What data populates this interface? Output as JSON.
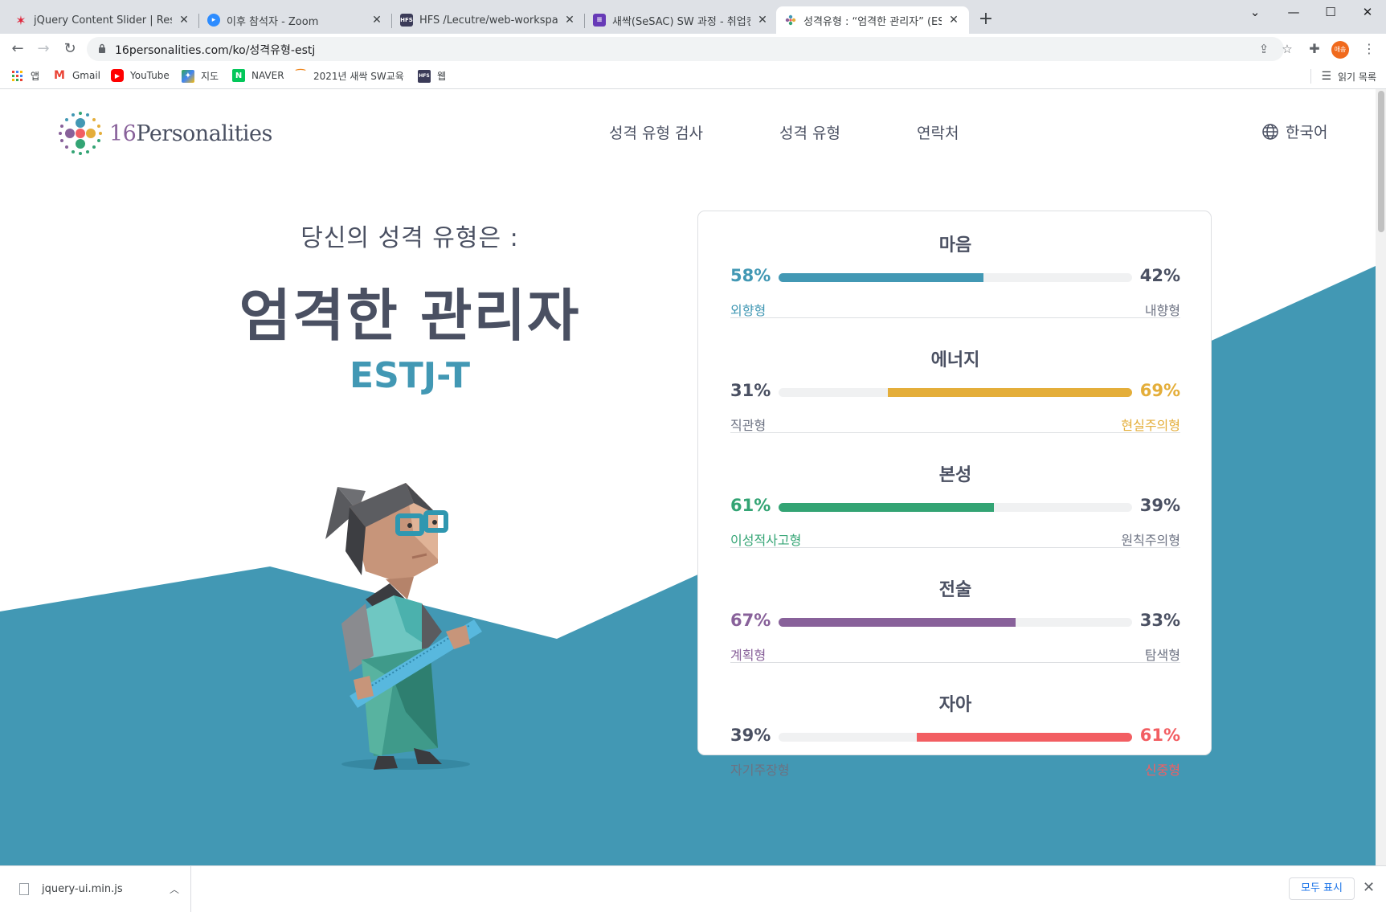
{
  "browser": {
    "tabs": [
      {
        "title": "jQuery Content Slider | Respons",
        "favicon": "red-star"
      },
      {
        "title": "이후 참석자 - Zoom",
        "favicon": "zoom"
      },
      {
        "title": "HFS /Lecutre/web-workspace/Le",
        "favicon": "hfs"
      },
      {
        "title": "새싹(SeSAC) SW 과정 - 취업컨설",
        "favicon": "forms"
      },
      {
        "title": "성격유형 : “엄격한 관리자” (EST.",
        "favicon": "16p"
      }
    ],
    "url": "16personalities.com/ko/성격유형-estj",
    "profile_label": "애송",
    "bookmarks": [
      {
        "label": "앱",
        "icon": "apps-grid-icon"
      },
      {
        "label": "Gmail",
        "icon": "gmail-icon"
      },
      {
        "label": "YouTube",
        "icon": "youtube-icon"
      },
      {
        "label": "지도",
        "icon": "maps-icon"
      },
      {
        "label": "NAVER",
        "icon": "naver-icon"
      },
      {
        "label": "2021년 새싹 SW교육",
        "icon": "sesac-icon"
      },
      {
        "label": "웹",
        "icon": "hfs-icon"
      }
    ],
    "reading_list": "읽기 목록"
  },
  "site": {
    "logo_num": "16",
    "logo_word": "Personalities",
    "nav": [
      "성격 유형 검사",
      "성격 유형",
      "연락처"
    ],
    "language": "한국어"
  },
  "result": {
    "intro": "당신의 성격 유형은 :",
    "type_name": "엄격한 관리자",
    "type_code": "ESTJ-T"
  },
  "traits": [
    {
      "name": "마음",
      "left_pct": "58%",
      "right_pct": "42%",
      "left_label": "외향형",
      "right_label": "내향형",
      "dominant": "left",
      "fill": 0.58,
      "color": "#4298b4"
    },
    {
      "name": "에너지",
      "left_pct": "31%",
      "right_pct": "69%",
      "left_label": "직관형",
      "right_label": "현실주의형",
      "dominant": "right",
      "fill": 0.69,
      "color": "#e4ae3a"
    },
    {
      "name": "본성",
      "left_pct": "61%",
      "right_pct": "39%",
      "left_label": "이성적사고형",
      "right_label": "원칙주의형",
      "dominant": "left",
      "fill": 0.61,
      "color": "#33a474"
    },
    {
      "name": "전술",
      "left_pct": "67%",
      "right_pct": "33%",
      "left_label": "계획형",
      "right_label": "탐색형",
      "dominant": "left",
      "fill": 0.67,
      "color": "#88619a"
    },
    {
      "name": "자아",
      "left_pct": "39%",
      "right_pct": "61%",
      "left_label": "자기주장형",
      "right_label": "신중형",
      "dominant": "right",
      "fill": 0.61,
      "color": "#f25e62"
    }
  ],
  "downloads": {
    "file": "jquery-ui.min.js",
    "show_all": "모두 표시"
  }
}
